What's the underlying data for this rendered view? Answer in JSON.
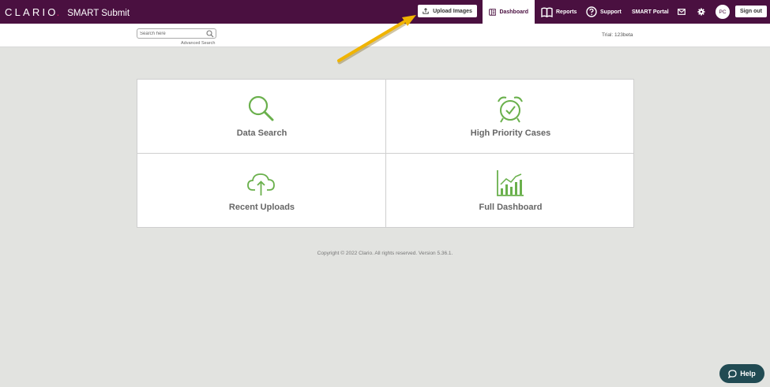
{
  "header": {
    "logo": "CLARIO",
    "logo_dot": ".",
    "app_name": "SMART Submit",
    "upload_label": "Upload Images",
    "nav": {
      "dashboard": "Dashboard",
      "reports": "Reports",
      "support": "Support",
      "smart_portal": "SMART Portal"
    },
    "avatar_initials": "PC",
    "signout_label": "Sign out"
  },
  "search": {
    "placeholder": "Search here",
    "advanced_label": "Advanced Search"
  },
  "trial_text": "Trial: 123beta",
  "tiles": [
    {
      "label": "Data Search",
      "icon": "magnifier-icon"
    },
    {
      "label": "High Priority Cases",
      "icon": "alarm-clock-icon"
    },
    {
      "label": "Recent Uploads",
      "icon": "cloud-upload-icon"
    },
    {
      "label": "Full Dashboard",
      "icon": "bar-chart-icon"
    }
  ],
  "footer": {
    "copyright": "Copyright © 2022 Clario. All rights reserved. Version 5.36.1."
  },
  "help_label": "Help",
  "colors": {
    "header_bg": "#4a1040",
    "accent_green": "#6ab04c",
    "annotation_arrow": "#f0b400",
    "help_bg": "#214b53",
    "page_bg": "#e2e3e0"
  }
}
